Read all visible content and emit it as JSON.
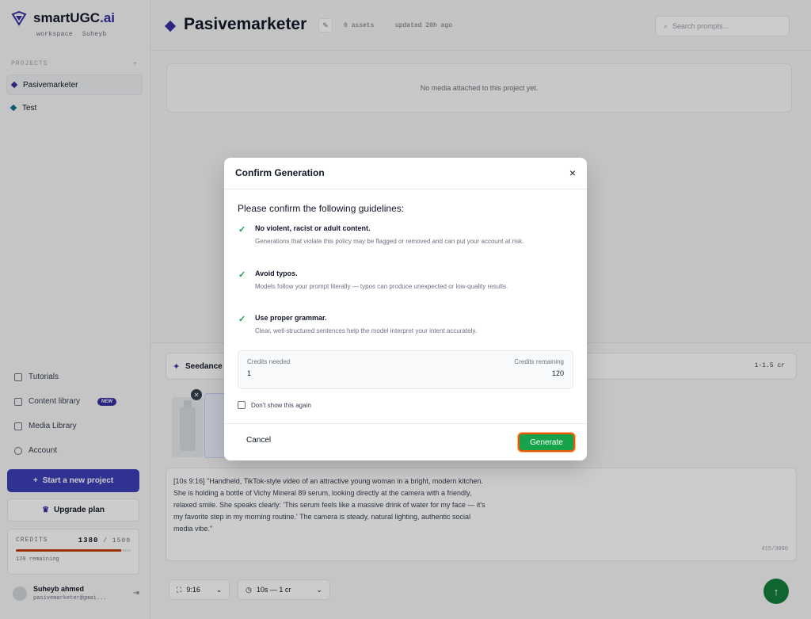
{
  "sidebar": {
    "brand": {
      "name_main": "smartUGC",
      "name_accent": ".ai",
      "workspace_label": "workspace",
      "user_label": "Suheyb"
    },
    "projects_header": "PROJECTS",
    "projects_add": "+",
    "projects": [
      {
        "label": "Pasivemarketer",
        "active": true
      },
      {
        "label": "Test",
        "active": false
      }
    ],
    "nav": [
      {
        "label": "Tutorials",
        "icon": "book-icon"
      },
      {
        "label": "Content library",
        "icon": "layers-icon",
        "badge": "NEW"
      },
      {
        "label": "Media Library",
        "icon": "image-icon"
      },
      {
        "label": "Account",
        "icon": "user-icon"
      }
    ],
    "new_project_label": "Start a new project",
    "upgrade_label": "Upgrade plan",
    "credits": {
      "label": "CREDITS",
      "used": "1380",
      "total": "/ 1500",
      "remaining_text": "120 remaining",
      "fill_fraction": 0.92
    },
    "user": {
      "name": "Suheyb ahmed",
      "email": "pasivemarketer@gmai..."
    }
  },
  "header": {
    "title": "Pasivemarketer",
    "assets": "0 assets",
    "updated": "updated 20h ago",
    "search_placeholder": "Search prompts..."
  },
  "main": {
    "empty_media": "No media attached to this project yet.",
    "model_name": "Seedance",
    "model_cost": "1-1.5 cr",
    "prompt": "[10s 9:16] \"Handheld, TikTok-style video of an attractive young woman in a bright, modern kitchen. She is holding a bottle of Vichy Mineral 89 serum, looking directly at the camera with a friendly, relaxed smile. She speaks clearly: 'This serum feels like a massive drink of water for my face — it's my favorite step in my morning routine.' The camera is steady, natural lighting, authentic social media vibe.\"",
    "prompt_count": "415/3000",
    "aspect": "9:16",
    "duration": "10s — 1 cr"
  },
  "modal": {
    "title": "Confirm Generation",
    "close": "×",
    "guide_title": "Please confirm the following guidelines:",
    "guidelines": [
      {
        "heading": "No violent, racist or adult content.",
        "desc": "Generations that violate this policy may be flagged or removed and can put your account at risk."
      },
      {
        "heading": "Avoid typos.",
        "desc": "Models follow your prompt literally — typos can produce unexpected or low-quality results."
      },
      {
        "heading": "Use proper grammar.",
        "desc": "Clear, well-structured sentences help the model interpret your intent accurately."
      }
    ],
    "credits_needed_label": "Credits needed",
    "credits_needed": "1",
    "credits_remaining_label": "Credits remaining",
    "credits_remaining": "120",
    "dont_show": "Don't show this again",
    "cancel": "Cancel",
    "generate": "Generate"
  },
  "colors": {
    "brand": "#3730a3",
    "generate": "#16a34a",
    "highlight": "#ea580c"
  }
}
